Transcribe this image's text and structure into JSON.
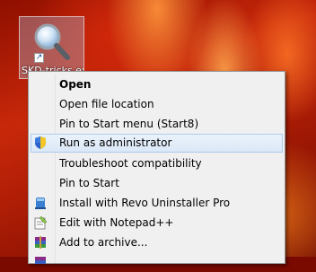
{
  "desktop": {
    "icon_label": "SKD-tricks.exe"
  },
  "context_menu": {
    "items": [
      {
        "label": "Open",
        "bold": true,
        "icon": null
      },
      {
        "label": "Open file location",
        "icon": null
      },
      {
        "label": "Pin to Start menu (Start8)",
        "icon": null
      },
      {
        "label": "Run as administrator",
        "icon": "uac-shield-icon",
        "highlighted": true
      },
      {
        "label": "Troubleshoot compatibility",
        "icon": null
      },
      {
        "label": "Pin to Start",
        "icon": null
      },
      {
        "label": "Install with Revo Uninstaller Pro",
        "icon": "revo-uninstaller-icon"
      },
      {
        "label": "Edit with Notepad++",
        "icon": "notepadpp-icon"
      },
      {
        "label": "Add to archive...",
        "icon": "winrar-icon"
      }
    ]
  }
}
